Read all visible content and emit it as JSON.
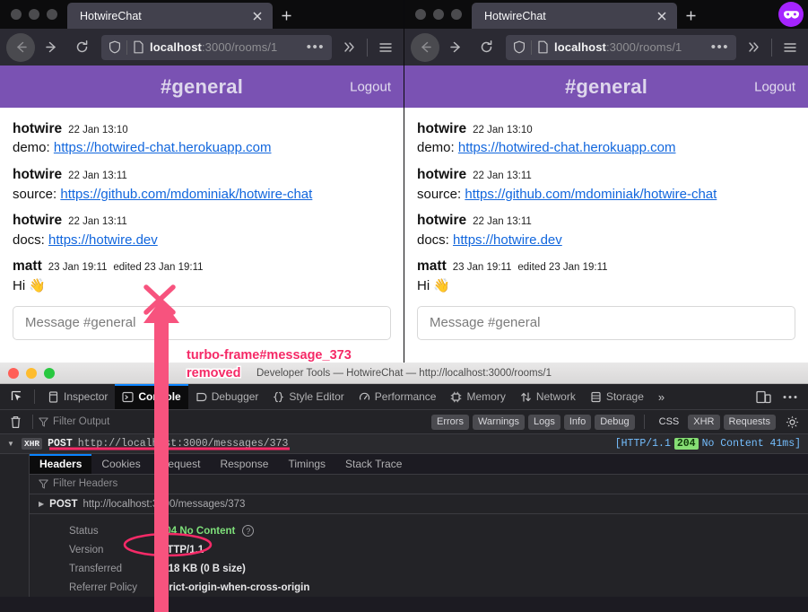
{
  "windows": [
    {
      "tab_title": "HotwireChat",
      "url_host": "localhost",
      "url_path": ":3000/rooms/1",
      "private": false
    },
    {
      "tab_title": "HotwireChat",
      "url_host": "localhost",
      "url_path": ":3000/rooms/1",
      "private": true
    }
  ],
  "chat": {
    "room_title": "#general",
    "logout_label": "Logout",
    "composer_placeholder": "Message #general",
    "messages": [
      {
        "author": "hotwire",
        "time": "22 Jan 13:10",
        "edited": "",
        "prefix": "demo: ",
        "link": "https://hotwired-chat.herokuapp.com"
      },
      {
        "author": "hotwire",
        "time": "22 Jan 13:11",
        "edited": "",
        "prefix": "source: ",
        "link": "https://github.com/mdominiak/hotwire-chat"
      },
      {
        "author": "hotwire",
        "time": "22 Jan 13:11",
        "edited": "",
        "prefix": "docs: ",
        "link": "https://hotwire.dev"
      },
      {
        "author": "matt",
        "time": "23 Jan 19:11",
        "edited": "edited 23 Jan 19:11",
        "prefix": "Hi 👋",
        "link": ""
      }
    ]
  },
  "devtools": {
    "window_title": "Developer Tools — HotwireChat — http://localhost:3000/rooms/1",
    "toolbar_tabs": [
      {
        "label": "Inspector",
        "icon": "inspector-icon",
        "active": false
      },
      {
        "label": "Console",
        "icon": "console-icon",
        "active": true
      },
      {
        "label": "Debugger",
        "icon": "debugger-icon",
        "active": false
      },
      {
        "label": "Style Editor",
        "icon": "style-editor-icon",
        "active": false
      },
      {
        "label": "Performance",
        "icon": "performance-icon",
        "active": false
      },
      {
        "label": "Memory",
        "icon": "memory-icon",
        "active": false
      },
      {
        "label": "Network",
        "icon": "network-icon",
        "active": false
      },
      {
        "label": "Storage",
        "icon": "storage-icon",
        "active": false
      }
    ],
    "toolbar_overflow": "»",
    "filter_placeholder": "Filter Output",
    "severity_filters": [
      {
        "label": "Errors",
        "on": true
      },
      {
        "label": "Warnings",
        "on": true
      },
      {
        "label": "Logs",
        "on": true
      },
      {
        "label": "Info",
        "on": true
      },
      {
        "label": "Debug",
        "on": true
      }
    ],
    "type_filters": [
      {
        "label": "CSS",
        "on": false
      },
      {
        "label": "XHR",
        "on": true
      },
      {
        "label": "Requests",
        "on": true
      }
    ],
    "log_entry": {
      "badge": "XHR",
      "method": "POST",
      "url": "http://localhost:3000/messages/373",
      "status_prefix": "[HTTP/1.1",
      "status_code": "204",
      "status_text": "No Content 41ms]"
    },
    "detail_tabs": [
      {
        "label": "Headers",
        "active": true
      },
      {
        "label": "Cookies",
        "active": false
      },
      {
        "label": "Request",
        "active": false
      },
      {
        "label": "Response",
        "active": false
      },
      {
        "label": "Timings",
        "active": false
      },
      {
        "label": "Stack Trace",
        "active": false
      }
    ],
    "headers_filter_placeholder": "Filter Headers",
    "request_row": {
      "method": "POST",
      "url": "http://localhost:3000/messages/373"
    },
    "headers": [
      {
        "key": "Status",
        "value": "204 No Content",
        "status": true,
        "help": "?"
      },
      {
        "key": "Version",
        "value": "HTTP/1.1",
        "status": false,
        "help": ""
      },
      {
        "key": "Transferred",
        "value": "2.18 KB (0 B size)",
        "status": false,
        "help": ""
      },
      {
        "key": "Referrer Policy",
        "value": "strict-origin-when-cross-origin",
        "status": false,
        "help": ""
      }
    ]
  },
  "annotations": {
    "label_line1": "turbo-frame#message_373",
    "label_line2": "removed",
    "accent_color": "#f52a67"
  }
}
